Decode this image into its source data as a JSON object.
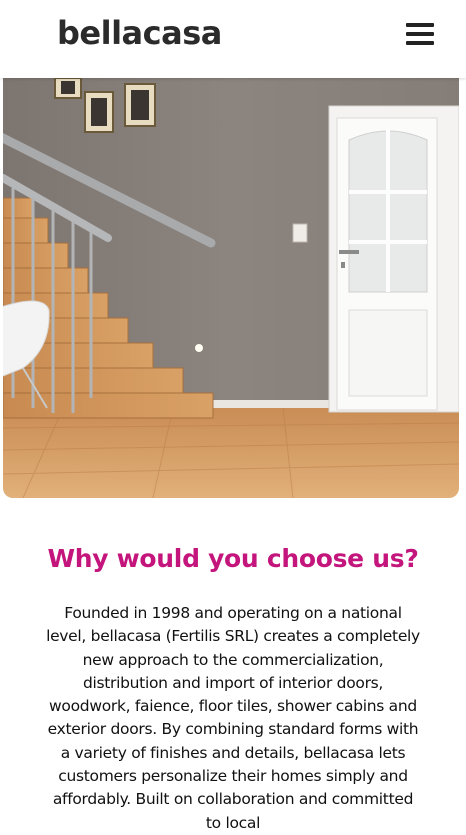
{
  "header": {
    "brand": "bellacasa",
    "menu_icon": "hamburger-menu-icon"
  },
  "hero": {
    "image_description_icon": "hero-photo"
  },
  "section": {
    "title": "Why would you choose us?",
    "body": "Founded in 1998 and operating on a national level, bellacasa (Fertilis SRL) creates a completely new approach to the commercialization, distribution and import of interior doors, woodwork, faience, floor tiles, shower cabins and exterior doors. By combining standard forms with a variety of finishes and details, bellacasa lets customers personalize their homes simply and affordably. Built on collaboration and committed to local"
  },
  "colors": {
    "accent": "#c4157c",
    "text": "#111111",
    "brand": "#2b2b2b"
  }
}
